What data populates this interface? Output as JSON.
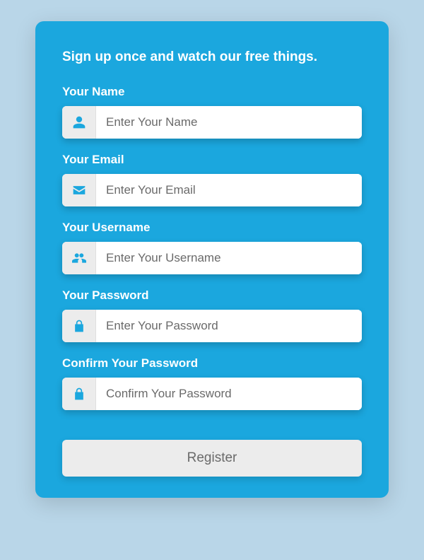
{
  "heading": "Sign up once and watch our free things.",
  "fields": {
    "name": {
      "label": "Your Name",
      "placeholder": "Enter Your Name"
    },
    "email": {
      "label": "Your Email",
      "placeholder": "Enter Your Email"
    },
    "username": {
      "label": "Your Username",
      "placeholder": "Enter Your Username"
    },
    "password": {
      "label": "Your Password",
      "placeholder": "Enter Your Password"
    },
    "confirm": {
      "label": "Confirm Your Password",
      "placeholder": "Confirm Your Password"
    }
  },
  "register_label": "Register",
  "colors": {
    "card_bg": "#1ba7de",
    "page_bg": "#b9d6e8",
    "icon_color": "#1ba7de"
  }
}
